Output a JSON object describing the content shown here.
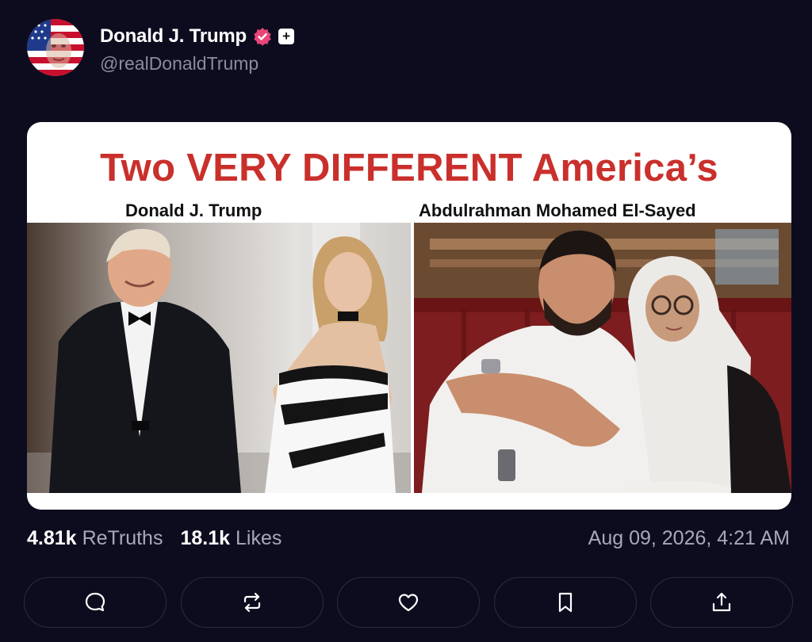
{
  "post": {
    "author": {
      "display_name": "Donald J. Trump",
      "handle": "@realDonaldTrump",
      "avatar_icon": "flag-portrait-avatar",
      "verified_icon": "verified-badge-icon",
      "verified_color": "#e8457a"
    },
    "image": {
      "title": "Two VERY DIFFERENT America’s",
      "left_caption": "Donald J. Trump",
      "right_caption": "Abdulrahman Mohamed El-Sayed",
      "title_color": "#c9302c"
    },
    "stats": {
      "retruths_count": "4.81k",
      "retruths_label": "ReTruths",
      "likes_count": "18.1k",
      "likes_label": "Likes"
    },
    "timestamp": "Aug 09, 2026, 4:21 AM",
    "actions": [
      {
        "name": "reply",
        "icon": "comment-icon"
      },
      {
        "name": "retruth",
        "icon": "repost-icon"
      },
      {
        "name": "like",
        "icon": "heart-icon"
      },
      {
        "name": "bookmark",
        "icon": "bookmark-icon"
      },
      {
        "name": "share",
        "icon": "share-icon"
      }
    ]
  }
}
